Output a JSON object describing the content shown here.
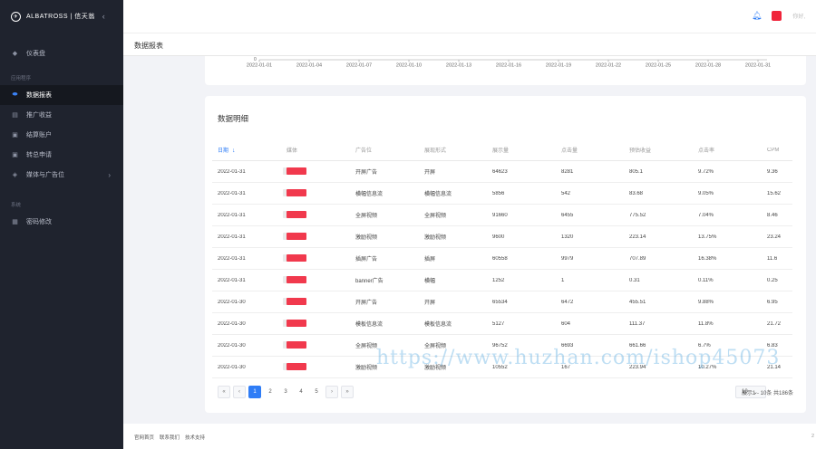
{
  "brand": {
    "name": "ALBATROSS | 信天翁"
  },
  "sidebar": {
    "items_top": [
      {
        "label": "仪表盘",
        "icon": "dashboard-icon"
      }
    ],
    "group1": "应用程序",
    "items": [
      {
        "label": "数据报表",
        "icon": "toggle-icon",
        "active": true
      },
      {
        "label": "推广收益",
        "icon": "book-icon"
      },
      {
        "label": "结算账户",
        "icon": "card-icon"
      },
      {
        "label": "转总申请",
        "icon": "transfer-icon"
      },
      {
        "label": "媒体与广告位",
        "icon": "cube-icon",
        "has_children": true
      }
    ],
    "group2": "系统",
    "items_bottom": [
      {
        "label": "密码修改",
        "icon": "lock-icon"
      }
    ]
  },
  "topbar": {
    "greeting": "你好,"
  },
  "page": {
    "title": "数据报表"
  },
  "chart_data": {
    "type": "line",
    "x": [
      "2022-01-01",
      "2022-01-04",
      "2022-01-07",
      "2022-01-10",
      "2022-01-13",
      "2022-01-16",
      "2022-01-19",
      "2022-01-22",
      "2022-01-25",
      "2022-01-28",
      "2022-01-31"
    ],
    "y_tick": "0"
  },
  "table": {
    "title": "数据明细",
    "columns": [
      "日期",
      "媒体",
      "广告位",
      "展现形式",
      "展示量",
      "点击量",
      "预估收益",
      "点击率",
      "CPM"
    ],
    "rows": [
      [
        "2022-01-31",
        "",
        "开屏广告",
        "开屏",
        "64623",
        "8281",
        "805.1",
        "9.72%",
        "9.36"
      ],
      [
        "2022-01-31",
        "",
        "横幅信息流",
        "横幅信息流",
        "5856",
        "542",
        "83.68",
        "9.05%",
        "15.62"
      ],
      [
        "2022-01-31",
        "",
        "全屏视频",
        "全屏视频",
        "91660",
        "6455",
        "775.52",
        "7.04%",
        "8.46"
      ],
      [
        "2022-01-31",
        "",
        "激励视频",
        "激励视频",
        "9600",
        "1320",
        "223.14",
        "13.75%",
        "23.24"
      ],
      [
        "2022-01-31",
        "",
        "插屏广告",
        "插屏",
        "60558",
        "9979",
        "707.89",
        "16.38%",
        "11.6"
      ],
      [
        "2022-01-31",
        "",
        "banner广告",
        "横幅",
        "1252",
        "1",
        "0.31",
        "0.11%",
        "0.25"
      ],
      [
        "2022-01-30",
        "",
        "开屏广告",
        "开屏",
        "65534",
        "6472",
        "455.51",
        "9.88%",
        "6.95"
      ],
      [
        "2022-01-30",
        "",
        "模板信息流",
        "模板信息流",
        "5127",
        "604",
        "111.37",
        "11.8%",
        "21.72"
      ],
      [
        "2022-01-30",
        "",
        "全屏视频",
        "全屏视频",
        "96752",
        "6693",
        "661.66",
        "6.7%",
        "6.83"
      ],
      [
        "2022-01-30",
        "",
        "激励视频",
        "激励视频",
        "10552",
        "167",
        "223.94",
        "10.27%",
        "21.14"
      ]
    ]
  },
  "pagination": {
    "first": "«",
    "prev": "‹",
    "pages": [
      "1",
      "2",
      "3",
      "4",
      "5"
    ],
    "current": "1",
    "next": "›",
    "last": "»",
    "page_size": "10",
    "summary": "展示1 - 10条 共186条"
  },
  "footer": {
    "links": [
      "官网首页",
      "联系我们",
      "技术支持"
    ],
    "right": "2"
  },
  "watermark": "https://www.huzhan.com/ishop45073"
}
